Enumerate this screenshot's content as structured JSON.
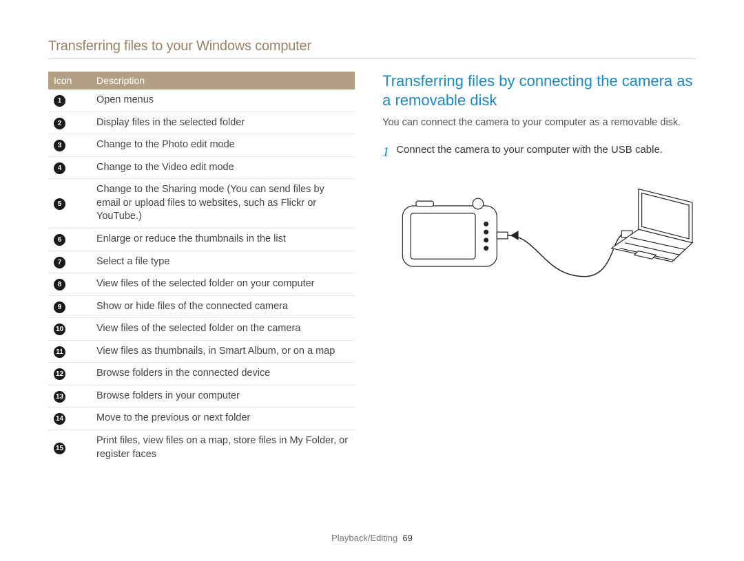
{
  "header": "Transferring files to your Windows computer",
  "table": {
    "headers": {
      "icon": "Icon",
      "desc": "Description"
    },
    "rows": [
      {
        "n": "1",
        "desc": "Open menus"
      },
      {
        "n": "2",
        "desc": "Display files in the selected folder"
      },
      {
        "n": "3",
        "desc": "Change to the Photo edit mode"
      },
      {
        "n": "4",
        "desc": "Change to the Video edit mode"
      },
      {
        "n": "5",
        "desc": "Change to the Sharing mode (You can send files by email or upload files to websites, such as Flickr or YouTube.)"
      },
      {
        "n": "6",
        "desc": "Enlarge or reduce the thumbnails in the list"
      },
      {
        "n": "7",
        "desc": "Select a file type"
      },
      {
        "n": "8",
        "desc": "View files of the selected folder on your computer"
      },
      {
        "n": "9",
        "desc": "Show or hide files of the connected camera"
      },
      {
        "n": "10",
        "desc": "View files of the selected folder on the camera"
      },
      {
        "n": "11",
        "desc": "View files as thumbnails, in Smart Album, or on a map"
      },
      {
        "n": "12",
        "desc": "Browse folders in the connected device"
      },
      {
        "n": "13",
        "desc": "Browse folders in your computer"
      },
      {
        "n": "14",
        "desc": "Move to the previous or next folder"
      },
      {
        "n": "15",
        "desc": "Print files, view files on a map, store files in My Folder, or register faces"
      }
    ]
  },
  "right": {
    "title": "Transferring files by connecting the camera as a removable disk",
    "intro": "You can connect the camera to your computer as a removable disk.",
    "steps": [
      {
        "num": "1",
        "text": "Connect the camera to your computer with the USB cable."
      }
    ]
  },
  "footer": {
    "section": "Playback/Editing",
    "page": "69"
  }
}
